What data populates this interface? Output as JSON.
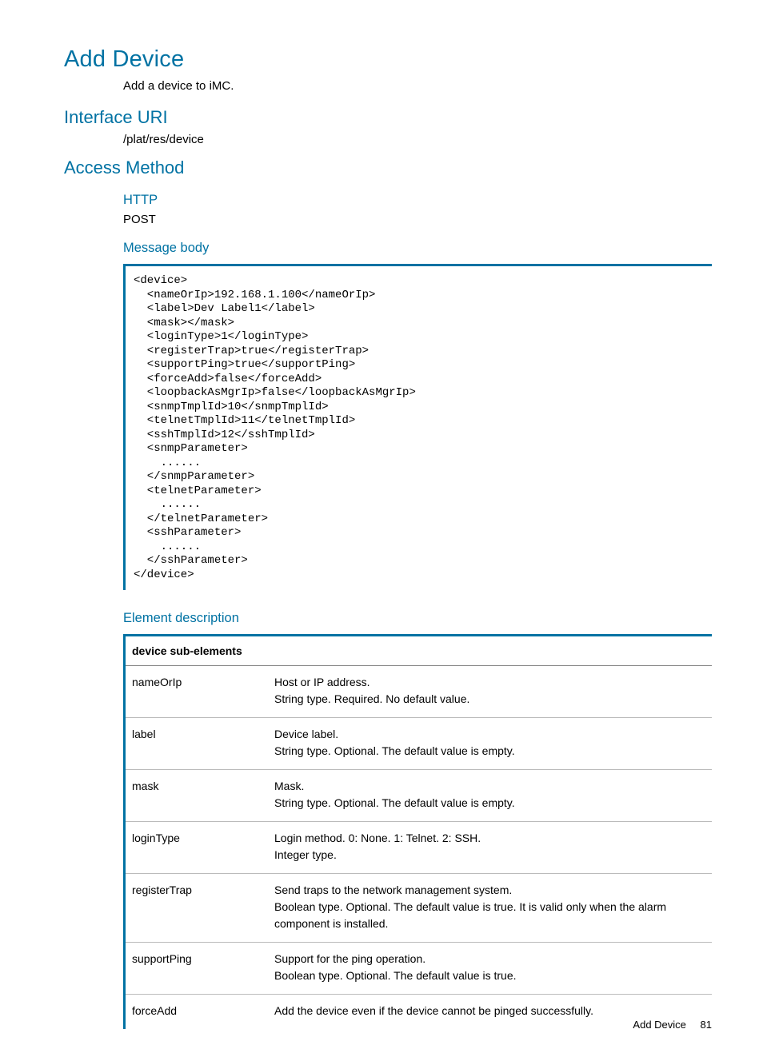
{
  "title": "Add Device",
  "intro": "Add a device to iMC.",
  "sections": {
    "interface_uri": {
      "heading": "Interface URI",
      "value": "/plat/res/device"
    },
    "access_method": {
      "heading": "Access Method",
      "http_heading": "HTTP",
      "http_method": "POST",
      "body_heading": "Message body",
      "code": "<device>\n  <nameOrIp>192.168.1.100</nameOrIp>\n  <label>Dev Label1</label>\n  <mask></mask>\n  <loginType>1</loginType>\n  <registerTrap>true</registerTrap>\n  <supportPing>true</supportPing>\n  <forceAdd>false</forceAdd>\n  <loopbackAsMgrIp>false</loopbackAsMgrIp>\n  <snmpTmplId>10</snmpTmplId>\n  <telnetTmplId>11</telnetTmplId>\n  <sshTmplId>12</sshTmplId>\n  <snmpParameter>\n    ......\n  </snmpParameter>\n  <telnetParameter>\n    ......\n  </telnetParameter>\n  <sshParameter>\n    ......\n  </sshParameter>\n</device>",
      "element_desc_heading": "Element description"
    }
  },
  "table": {
    "header": "device sub-elements",
    "rows": [
      {
        "name": "nameOrIp",
        "line1": "Host or IP address.",
        "line2": "String type. Required. No default value."
      },
      {
        "name": "label",
        "line1": "Device label.",
        "line2": "String type. Optional. The default value is empty."
      },
      {
        "name": "mask",
        "line1": "Mask.",
        "line2": "String type. Optional. The default value is empty."
      },
      {
        "name": "loginType",
        "line1": "Login method. 0: None. 1: Telnet. 2: SSH.",
        "line2": "Integer type."
      },
      {
        "name": "registerTrap",
        "line1": "Send traps to the network management system.",
        "line2": "Boolean type. Optional. The default value is true. It is valid only when the alarm component is installed."
      },
      {
        "name": "supportPing",
        "line1": "Support for the ping operation.",
        "line2": "Boolean type. Optional. The default value is true."
      },
      {
        "name": "forceAdd",
        "line1": "Add the device even if the device cannot be pinged successfully.",
        "line2": ""
      }
    ]
  },
  "footer": {
    "label": "Add Device",
    "page": "81"
  }
}
